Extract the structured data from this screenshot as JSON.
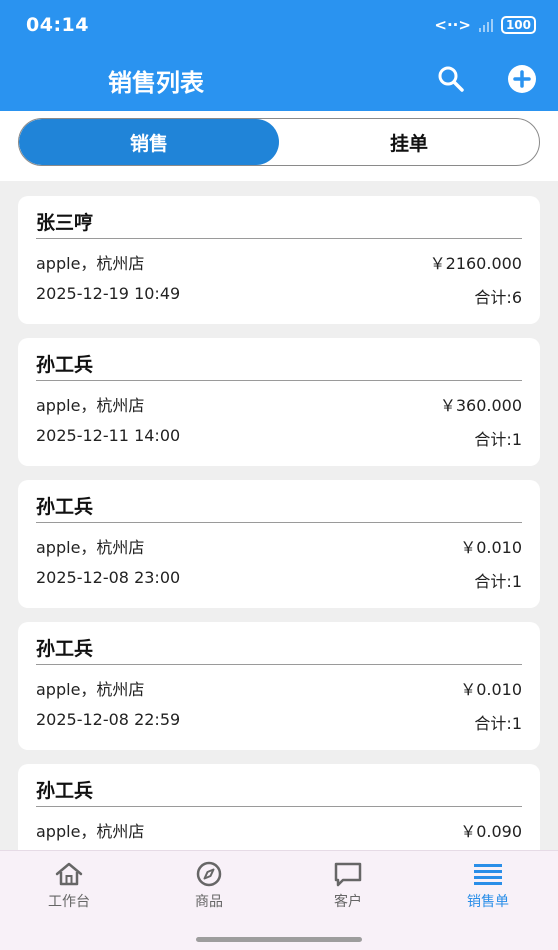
{
  "status": {
    "time": "04:14",
    "battery": "100"
  },
  "header": {
    "title": "销售列表"
  },
  "segments": [
    {
      "label": "销售",
      "active": true
    },
    {
      "label": "挂单",
      "active": false
    }
  ],
  "orders": [
    {
      "customer": "张三哼",
      "product": "apple，杭州店",
      "amount": "￥2160.000",
      "date": "2025-12-19 10:49",
      "total": "合计:6"
    },
    {
      "customer": "孙工兵",
      "product": "apple，杭州店",
      "amount": "￥360.000",
      "date": "2025-12-11 14:00",
      "total": "合计:1"
    },
    {
      "customer": "孙工兵",
      "product": "apple，杭州店",
      "amount": "￥0.010",
      "date": "2025-12-08 23:00",
      "total": "合计:1"
    },
    {
      "customer": "孙工兵",
      "product": "apple，杭州店",
      "amount": "￥0.010",
      "date": "2025-12-08 22:59",
      "total": "合计:1"
    },
    {
      "customer": "孙工兵",
      "product": "apple，杭州店",
      "amount": "￥0.090",
      "date": "",
      "total": ""
    }
  ],
  "tabs": [
    {
      "label": "工作台",
      "icon": "home-icon"
    },
    {
      "label": "商品",
      "icon": "compass-icon"
    },
    {
      "label": "客户",
      "icon": "chat-icon"
    },
    {
      "label": "销售单",
      "icon": "list-icon",
      "active": true
    }
  ],
  "colors": {
    "primary": "#2a93f0",
    "segment_active": "#2084d8",
    "tab_active": "#2a8ee8"
  }
}
